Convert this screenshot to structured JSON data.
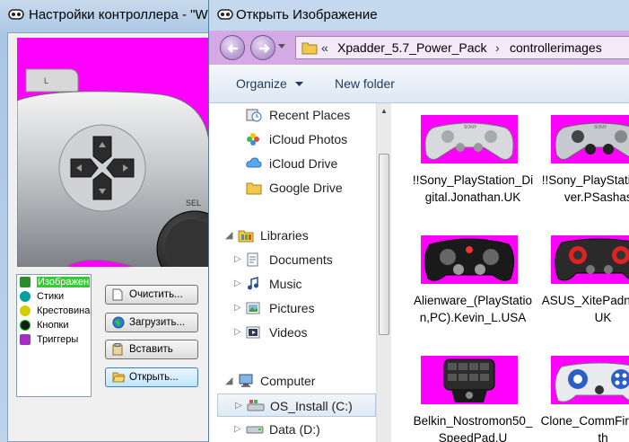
{
  "background_window": {
    "title": "Настройки контроллера - \"W",
    "list_items": [
      {
        "label": "Изображен",
        "selected": true,
        "color": "#2a8c2a"
      },
      {
        "label": "Стики",
        "selected": false,
        "color": "#00a0a0"
      },
      {
        "label": "Крестовина",
        "selected": false,
        "color": "#d0d000"
      },
      {
        "label": "Кнопки",
        "selected": false,
        "color": "#1a1a1a"
      },
      {
        "label": "Триггеры",
        "selected": false,
        "color": "#a030c0"
      }
    ],
    "buttons": {
      "clear": "Очистить...",
      "load": "Загрузить...",
      "paste": "Вставить",
      "open": "Открыть..."
    },
    "pad_labels": {
      "l": "L",
      "sel": "SEL"
    }
  },
  "dialog": {
    "title": "Открыть Изображение",
    "address": {
      "chevron": "«",
      "crumbs": [
        "Xpadder_5.7_Power_Pack",
        "controllerimages"
      ],
      "separator": "›"
    },
    "toolbar": {
      "organize": "Organize",
      "new_folder": "New folder"
    },
    "nav": {
      "recent_places": "Recent Places",
      "icloud_photos": "iCloud Photos",
      "icloud_drive": "iCloud Drive",
      "google_drive": "Google Drive",
      "libraries": "Libraries",
      "documents": "Documents",
      "music": "Music",
      "pictures": "Pictures",
      "videos": "Videos",
      "computer": "Computer",
      "os_install": "OS_Install (C:)",
      "data_d": "Data (D:)"
    },
    "files": [
      {
        "name": "!!Sony_PlayStation_Digital.Jonathan.UK"
      },
      {
        "name": "!!Sony_PlayStation_Silver.PSashasia"
      },
      {
        "name": "Alienware_(PlayStation,PC).Kevin_L.USA"
      },
      {
        "name": "ASUS_XitePadnathan.UK"
      },
      {
        "name": "Belkin_Nostromon50_SpeedPad.U"
      },
      {
        "name": "Clone_CommFire.Jonath"
      }
    ]
  },
  "colors": {
    "magenta": "#ff00ff",
    "aero_blue": "#b6cfe9",
    "nav_purple": "#d4a9e4",
    "selected_green": "#33cc33"
  }
}
